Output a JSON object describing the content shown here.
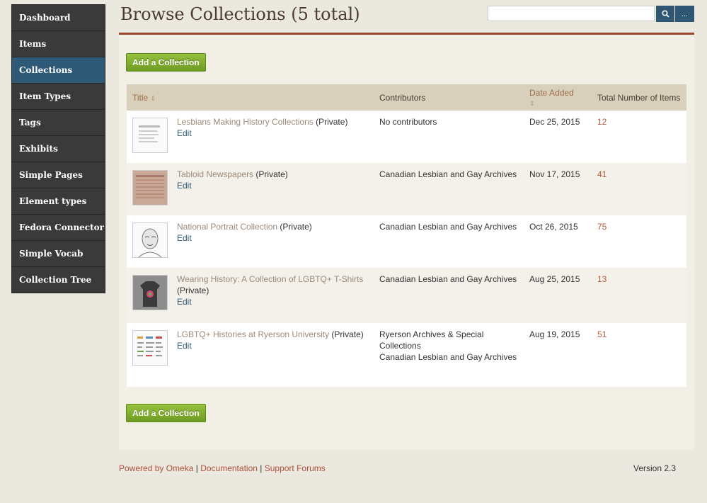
{
  "sidebar": {
    "items": [
      {
        "label": "Dashboard"
      },
      {
        "label": "Items"
      },
      {
        "label": "Collections"
      },
      {
        "label": "Item Types"
      },
      {
        "label": "Tags"
      },
      {
        "label": "Exhibits"
      },
      {
        "label": "Simple Pages"
      },
      {
        "label": "Element types"
      },
      {
        "label": "Fedora Connector"
      },
      {
        "label": "Simple Vocab"
      },
      {
        "label": "Collection Tree"
      }
    ]
  },
  "header": {
    "title": "Browse Collections (5 total)",
    "search_value": "",
    "advanced_label": "..."
  },
  "actions": {
    "add_collection": "Add a Collection"
  },
  "table": {
    "columns": {
      "title": "Title",
      "contributors": "Contributors",
      "date_added": "Date Added",
      "total": "Total Number of Items"
    },
    "rows": [
      {
        "title": "Lesbians Making History Collections",
        "status": "(Private)",
        "edit": "Edit",
        "contributors": [
          "No contributors"
        ],
        "date": "Dec 25, 2015",
        "count": "12"
      },
      {
        "title": "Tabloid Newspapers",
        "status": "(Private)",
        "edit": "Edit",
        "contributors": [
          "Canadian Lesbian and Gay Archives"
        ],
        "date": "Nov 17, 2015",
        "count": "41"
      },
      {
        "title": "National Portrait Collection",
        "status": "(Private)",
        "edit": "Edit",
        "contributors": [
          "Canadian Lesbian and Gay Archives"
        ],
        "date": "Oct 26, 2015",
        "count": "75"
      },
      {
        "title": "Wearing History: A Collection of LGBTQ+ T-Shirts",
        "status": "(Private)",
        "edit": "Edit",
        "contributors": [
          "Canadian Lesbian and Gay Archives"
        ],
        "date": "Aug 25, 2015",
        "count": "13"
      },
      {
        "title": "LGBTQ+ Histories at Ryerson University",
        "status": "(Private)",
        "edit": "Edit",
        "contributors": [
          "Ryerson Archives & Special Collections",
          "Canadian Lesbian and Gay Archives"
        ],
        "date": "Aug 19, 2015",
        "count": "51"
      }
    ]
  },
  "footer": {
    "powered": "Powered by Omeka",
    "documentation": "Documentation",
    "support": "Support Forums",
    "separator": "|",
    "version": "Version 2.3"
  }
}
